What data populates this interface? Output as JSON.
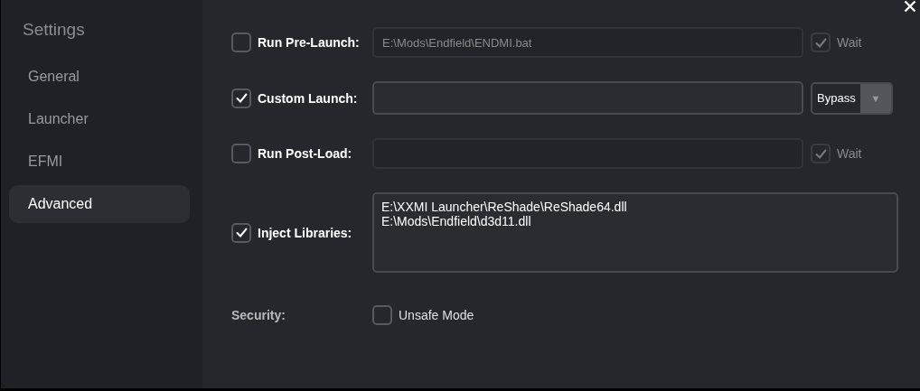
{
  "sidebar": {
    "title": "Settings",
    "items": [
      {
        "label": "General",
        "selected": false
      },
      {
        "label": "Launcher",
        "selected": false
      },
      {
        "label": "EFMI",
        "selected": false
      },
      {
        "label": "Advanced",
        "selected": true
      }
    ]
  },
  "rows": [
    {
      "kind": "command",
      "label": "Run Pre-Launch:",
      "checked": false,
      "field": {
        "value": "E:\\Mods\\Endfield\\ENDMI.bat",
        "disabled": true
      },
      "trailer": {
        "kind": "wait",
        "label": "Wait",
        "checked": true,
        "disabled": true
      }
    },
    {
      "kind": "command",
      "label": "Custom Launch:",
      "checked": true,
      "field": {
        "disabled": false
      },
      "trailer": {
        "kind": "dropdown",
        "value": "Bypass",
        "arrow": "▼"
      }
    },
    {
      "kind": "command",
      "label": "Run Post-Load:",
      "checked": false,
      "field": {
        "disabled": true
      },
      "trailer": {
        "kind": "wait",
        "label": "Wait",
        "checked": true,
        "disabled": true
      }
    },
    {
      "kind": "libraries",
      "label": "Inject Libraries:",
      "checked": true,
      "lines": [
        "E:\\XXMI Launcher\\ReShade\\ReShade64.dll",
        "E:\\Mods\\Endfield\\d3d11.dll"
      ]
    },
    {
      "kind": "security",
      "label": "Security:",
      "option": {
        "label": "Unsafe Mode",
        "checked": false
      }
    }
  ]
}
